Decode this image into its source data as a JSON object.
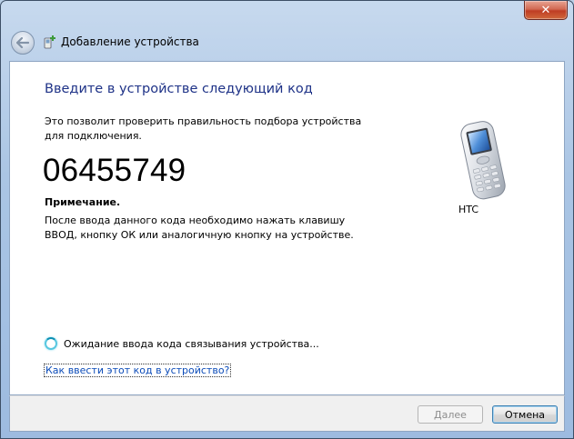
{
  "window": {
    "title": "Добавление устройства",
    "close_label": "✕"
  },
  "content": {
    "heading": "Введите в устройстве следующий код",
    "description": "Это позволит проверить правильность подбора устройства для подключения.",
    "code": "06455749",
    "note_title": "Примечание.",
    "note_text": "После ввода данного кода необходимо нажать клавишу ВВОД, кнопку ОК или аналогичную кнопку на устройстве.",
    "device_name": "HTC",
    "device_icon": "mobile-phone-icon",
    "status_text": "Ожидание ввода кода связывания устройства...",
    "help_link": "Как ввести этот код в устройство?"
  },
  "footer": {
    "next_label": "Далее",
    "cancel_label": "Отмена"
  },
  "colors": {
    "heading": "#1e3287",
    "link": "#0b4bb8",
    "close_button": "#c9452a"
  }
}
